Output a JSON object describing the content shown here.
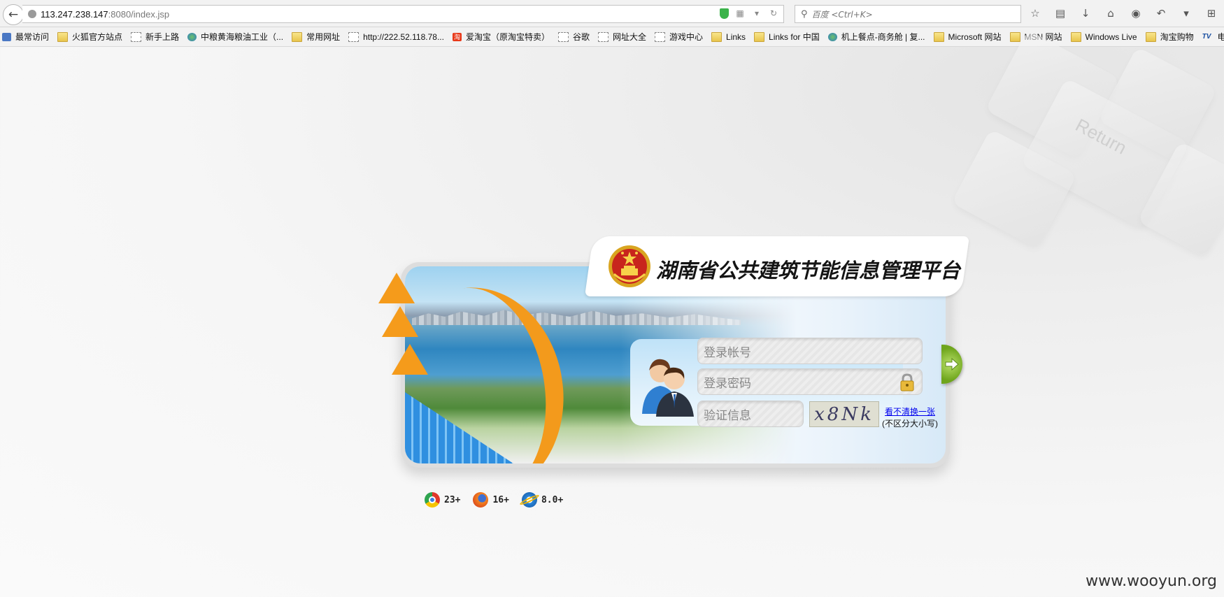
{
  "browser": {
    "url_host": "113.247.238.147",
    "url_path": ":8080/index.jsp",
    "search_placeholder": "百度 <Ctrl+K>"
  },
  "bookmarks": [
    {
      "label": "最常访问",
      "icon": "most-visited"
    },
    {
      "label": "火狐官方站点",
      "icon": "folder"
    },
    {
      "label": "新手上路",
      "icon": "page"
    },
    {
      "label": "中粮黄海粮油工业（...",
      "icon": "globe"
    },
    {
      "label": "常用网址",
      "icon": "folder"
    },
    {
      "label": "http://222.52.118.78...",
      "icon": "page"
    },
    {
      "label": "爱淘宝（原淘宝特卖）",
      "icon": "taobao"
    },
    {
      "label": "谷歌",
      "icon": "page"
    },
    {
      "label": "网址大全",
      "icon": "page"
    },
    {
      "label": "游戏中心",
      "icon": "page"
    },
    {
      "label": "Links",
      "icon": "folder"
    },
    {
      "label": "Links for 中国",
      "icon": "folder"
    },
    {
      "label": "机上餐点-商务舱 | 复...",
      "icon": "globe"
    },
    {
      "label": "Microsoft 网站",
      "icon": "folder"
    },
    {
      "label": "MSN 网站",
      "icon": "folder"
    },
    {
      "label": "Windows Live",
      "icon": "folder"
    },
    {
      "label": "淘宝购物",
      "icon": "folder"
    },
    {
      "label": "电视网 影",
      "icon": "tv"
    }
  ],
  "login": {
    "title": "湖南省公共建筑节能信息管理平台",
    "username_placeholder": "登录帐号",
    "password_placeholder": "登录密码",
    "captcha_placeholder": "验证信息",
    "captcha_text": "x8Nk",
    "refresh_link": "看不清换一张",
    "case_note": "(不区分大小写)"
  },
  "browser_support": [
    {
      "name": "chrome",
      "version": "23+"
    },
    {
      "name": "firefox",
      "version": "16+"
    },
    {
      "name": "ie",
      "version": "8.0+"
    }
  ],
  "watermark": "www.wooyun.org",
  "colors": {
    "accent_orange": "#f39a1c",
    "submit_green": "#6ea51c",
    "link_blue": "#0000ee"
  }
}
